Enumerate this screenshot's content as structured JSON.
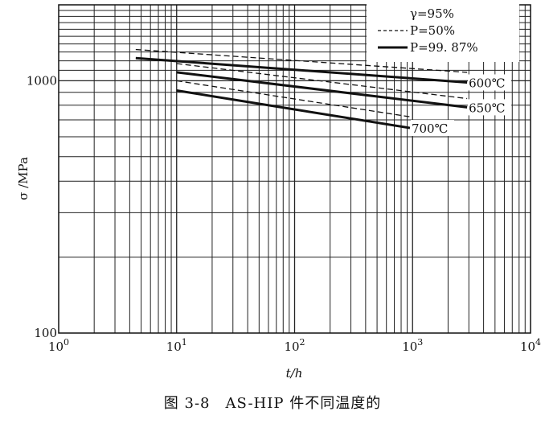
{
  "caption": "图 3-8　AS-HIP 件不同温度的",
  "chart_data": {
    "type": "line",
    "title": "",
    "xlabel": "t/h",
    "ylabel": "σ /MPa",
    "xscale": "log",
    "yscale": "log",
    "xlim": [
      1,
      10000
    ],
    "ylim": [
      100,
      2000
    ],
    "x_ticks": [
      {
        "value": 1,
        "base": "10",
        "exp": "0"
      },
      {
        "value": 10,
        "base": "10",
        "exp": "1"
      },
      {
        "value": 100,
        "base": "10",
        "exp": "2"
      },
      {
        "value": 1000,
        "base": "10",
        "exp": "3"
      },
      {
        "value": 10000,
        "base": "10",
        "exp": "4"
      }
    ],
    "y_ticks": [
      {
        "value": 100,
        "label": "100"
      },
      {
        "value": 1000,
        "label": "1000"
      }
    ],
    "grid": true,
    "legend_position": "top-right",
    "legend": [
      {
        "label": "γ=95%",
        "style": "none"
      },
      {
        "label": "P=50%",
        "style": "dashed"
      },
      {
        "label": "P=99. 87%",
        "style": "solid"
      }
    ],
    "series": [
      {
        "temperature": "600℃",
        "style": "dashed",
        "points": [
          [
            4.5,
            1330
          ],
          [
            2900,
            1080
          ]
        ]
      },
      {
        "temperature": "600℃",
        "style": "solid",
        "points": [
          [
            4.5,
            1230
          ],
          [
            2900,
            985
          ]
        ]
      },
      {
        "temperature": "650℃",
        "style": "dashed",
        "points": [
          [
            10,
            1170
          ],
          [
            2900,
            850
          ]
        ]
      },
      {
        "temperature": "650℃",
        "style": "solid",
        "points": [
          [
            10,
            1080
          ],
          [
            2900,
            785
          ]
        ]
      },
      {
        "temperature": "700℃",
        "style": "dashed",
        "points": [
          [
            10,
            1000
          ],
          [
            950,
            720
          ]
        ]
      },
      {
        "temperature": "700℃",
        "style": "solid",
        "points": [
          [
            10,
            915
          ],
          [
            950,
            650
          ]
        ]
      }
    ],
    "annotations": [
      {
        "text": "600℃",
        "at": [
          2900,
          985
        ]
      },
      {
        "text": "650℃",
        "at": [
          2900,
          785
        ]
      },
      {
        "text": "700℃",
        "at": [
          950,
          650
        ]
      }
    ]
  }
}
